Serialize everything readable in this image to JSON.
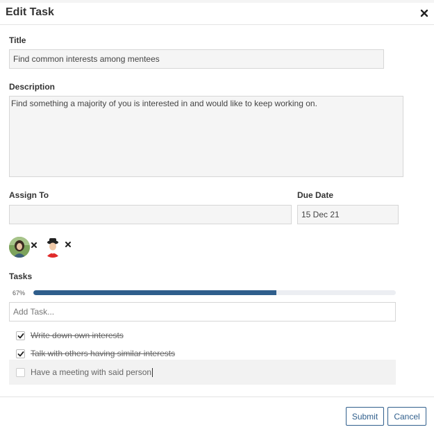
{
  "dialog": {
    "title": "Edit Task",
    "close_icon": "close-icon"
  },
  "form": {
    "title_label": "Title",
    "title_value": "Find common interests among mentees",
    "description_label": "Description",
    "description_value": "Find something a majority of you is interested in and would like to keep working on.",
    "assign_label": "Assign To",
    "assign_value": "",
    "due_label": "Due Date",
    "due_value": "15 Dec 21"
  },
  "assignees": [
    {
      "avatar": "avatar-woman",
      "remove_icon": "close-icon"
    },
    {
      "avatar": "avatar-man-hat",
      "remove_icon": "close-icon"
    }
  ],
  "tasks": {
    "label": "Tasks",
    "progress_text": "67%",
    "progress_fraction": 0.67,
    "add_placeholder": "Add Task...",
    "items": [
      {
        "text": "Write down own interests",
        "done": true
      },
      {
        "text": "Talk with others having similar interests",
        "done": true
      },
      {
        "text": "Have a meeting with said person",
        "done": false
      }
    ]
  },
  "buttons": {
    "submit": "Submit",
    "cancel": "Cancel"
  },
  "colors": {
    "accent": "#2f5e8c",
    "field_bg": "#f5f5f5"
  }
}
